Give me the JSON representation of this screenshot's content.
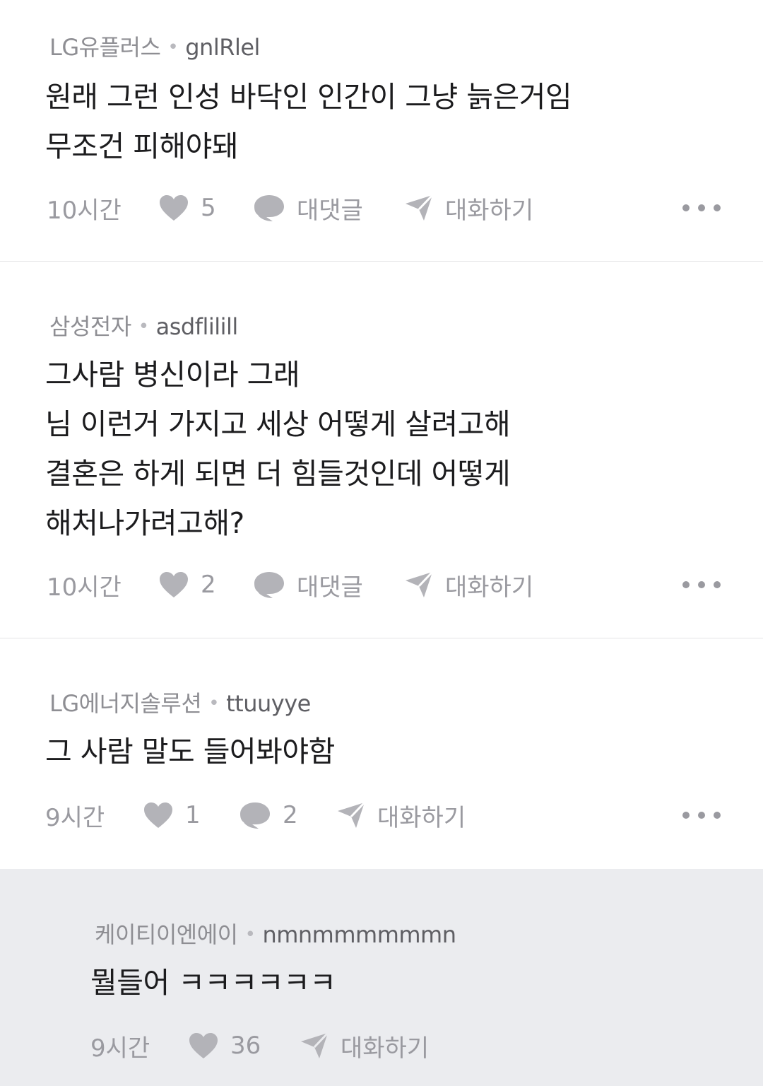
{
  "comments": [
    {
      "company": "LG유플러스",
      "nickname": "gnlRlel",
      "lines": [
        "원래 그런 인성 바닥인 인간이 그냥 늙은거임",
        "무조건 피해야돼"
      ],
      "time": "10시간",
      "likes": "5",
      "reply_label": "대댓글",
      "chat_label": "대화하기"
    },
    {
      "company": "삼성전자",
      "nickname": "asdflilill",
      "lines": [
        "그사람 병신이라 그래",
        "님 이런거 가지고 세상 어떻게 살려고해",
        "결혼은 하게 되면 더 힘들것인데 어떻게",
        "해처나가려고해?"
      ],
      "time": "10시간",
      "likes": "2",
      "reply_label": "대댓글",
      "chat_label": "대화하기"
    },
    {
      "company": "LG에너지솔루션",
      "nickname": "ttuuyye",
      "lines": [
        "그 사람 말도 들어봐야함"
      ],
      "time": "9시간",
      "likes": "1",
      "reply_count": "2",
      "chat_label": "대화하기"
    }
  ],
  "reply": {
    "company": "케이티이엔에이",
    "nickname": "nmnmmmmmmn",
    "lines": [
      "뭘들어 ㅋㅋㅋㅋㅋㅋ"
    ],
    "time": "9시간",
    "likes": "36",
    "chat_label": "대화하기"
  },
  "icons": {
    "like": "heart-icon",
    "reply": "speech-bubble-icon",
    "chat": "paper-plane-icon",
    "more": "more-dots-icon"
  },
  "colors": {
    "text": "#1c1c1e",
    "meta": "#8e8e93",
    "icon": "#b3b3b8",
    "reply_bg": "#ebecef",
    "divider": "#e4e4e6"
  }
}
